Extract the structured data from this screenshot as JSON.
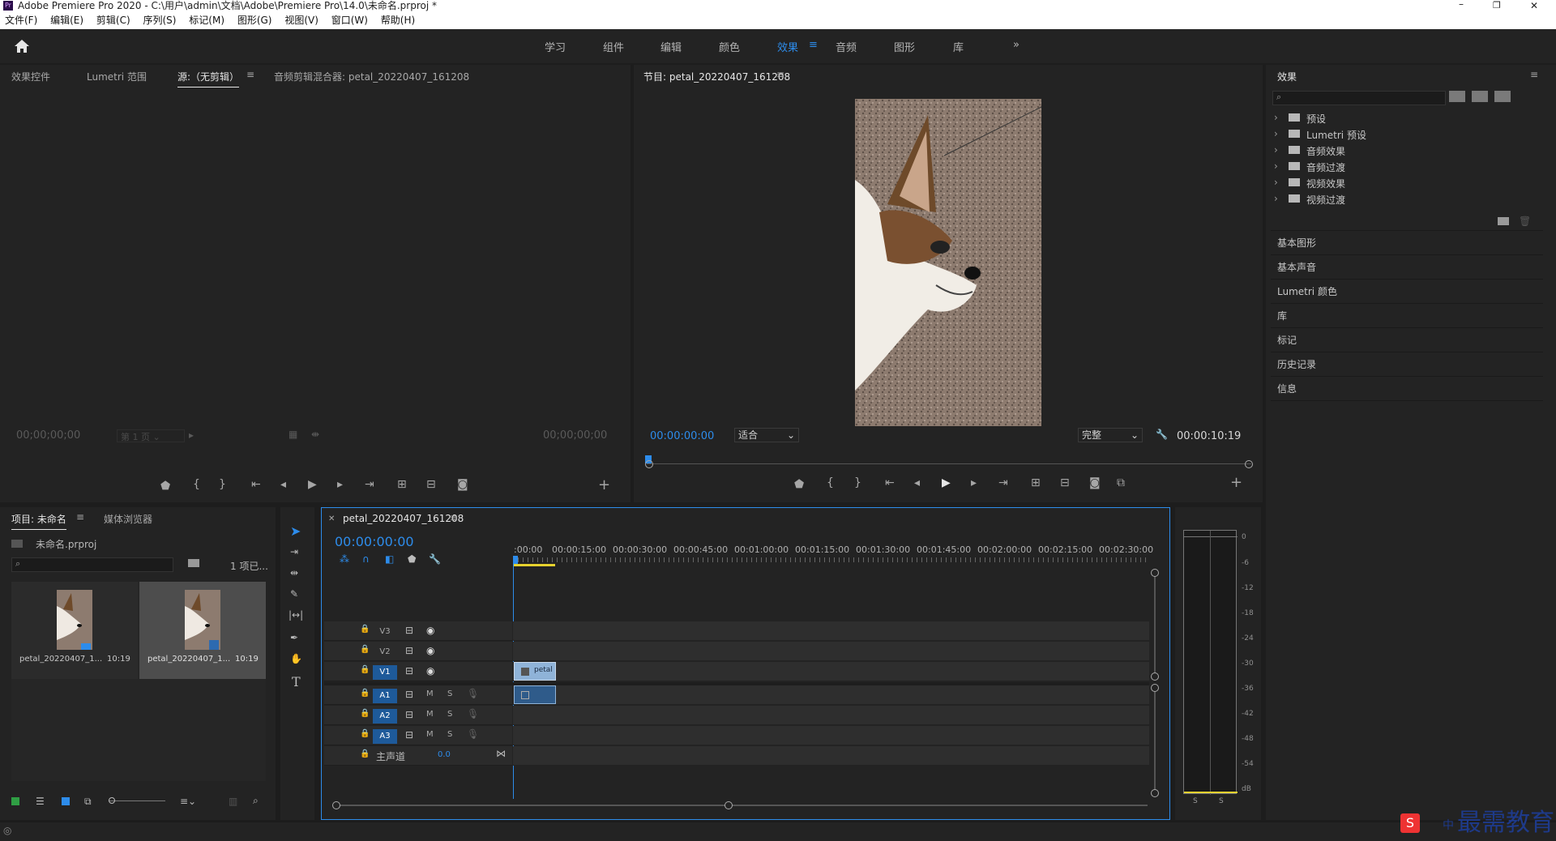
{
  "window": {
    "title": "Adobe Premiere Pro 2020 - C:\\用户\\admin\\文档\\Adobe\\Premiere Pro\\14.0\\未命名.prproj *",
    "controls": [
      "–",
      "❐",
      "✕"
    ]
  },
  "menu": [
    "文件(F)",
    "编辑(E)",
    "剪辑(C)",
    "序列(S)",
    "标记(M)",
    "图形(G)",
    "视图(V)",
    "窗口(W)",
    "帮助(H)"
  ],
  "workspaces": {
    "items": [
      "学习",
      "组件",
      "编辑",
      "颜色",
      "效果",
      "音频",
      "图形",
      "库"
    ],
    "active": "效果",
    "more": "»"
  },
  "source_panel": {
    "tabs": [
      "效果控件",
      "Lumetri 范围",
      "源:（无剪辑）",
      "音频剪辑混合器: petal_20220407_161208"
    ],
    "active_tab": "源:（无剪辑）",
    "timecode_left": "00;00;00;00",
    "page_select": "第 1 页",
    "timecode_right": "00;00;00;00"
  },
  "program_panel": {
    "title": "节目: petal_20220407_161208",
    "timecode": "00:00:00:00",
    "fit": "适合",
    "quality": "完整",
    "duration": "00:00:10:19"
  },
  "effects_panel": {
    "title": "效果",
    "tree": [
      "预设",
      "Lumetri 预设",
      "音频效果",
      "音频过渡",
      "视频效果",
      "视频过渡"
    ],
    "sections": [
      "基本图形",
      "基本声音",
      "Lumetri 颜色",
      "库",
      "标记",
      "历史记录",
      "信息"
    ]
  },
  "project_panel": {
    "tabs": [
      "项目: 未命名",
      "媒体浏览器"
    ],
    "file": "未命名.prproj",
    "items_count": "1 项已...",
    "clips": [
      {
        "name": "petal_20220407_1...",
        "duration": "10:19"
      },
      {
        "name": "petal_20220407_1...",
        "duration": "10:19"
      }
    ]
  },
  "timeline": {
    "tab": "petal_20220407_161208",
    "timecode": "00:00:00:00",
    "ruler": [
      ":00:00",
      "00:00:15:00",
      "00:00:30:00",
      "00:00:45:00",
      "00:01:00:00",
      "00:01:15:00",
      "00:01:30:00",
      "00:01:45:00",
      "00:02:00:00",
      "00:02:15:00",
      "00:02:30:00"
    ],
    "video_tracks": [
      "V3",
      "V2",
      "V1"
    ],
    "audio_tracks": [
      "A1",
      "A2",
      "A3"
    ],
    "master": {
      "label": "主声道",
      "value": "0.0"
    },
    "clip_label": "petal",
    "m_label": "M",
    "s_label": "S"
  },
  "meter": {
    "scale": [
      "0",
      "-6",
      "-12",
      "-18",
      "-24",
      "-30",
      "-36",
      "-42",
      "-48",
      "-54",
      "dB"
    ],
    "solo": [
      "S",
      "S"
    ]
  },
  "watermark": {
    "text": "最需教育",
    "ime": "中"
  }
}
